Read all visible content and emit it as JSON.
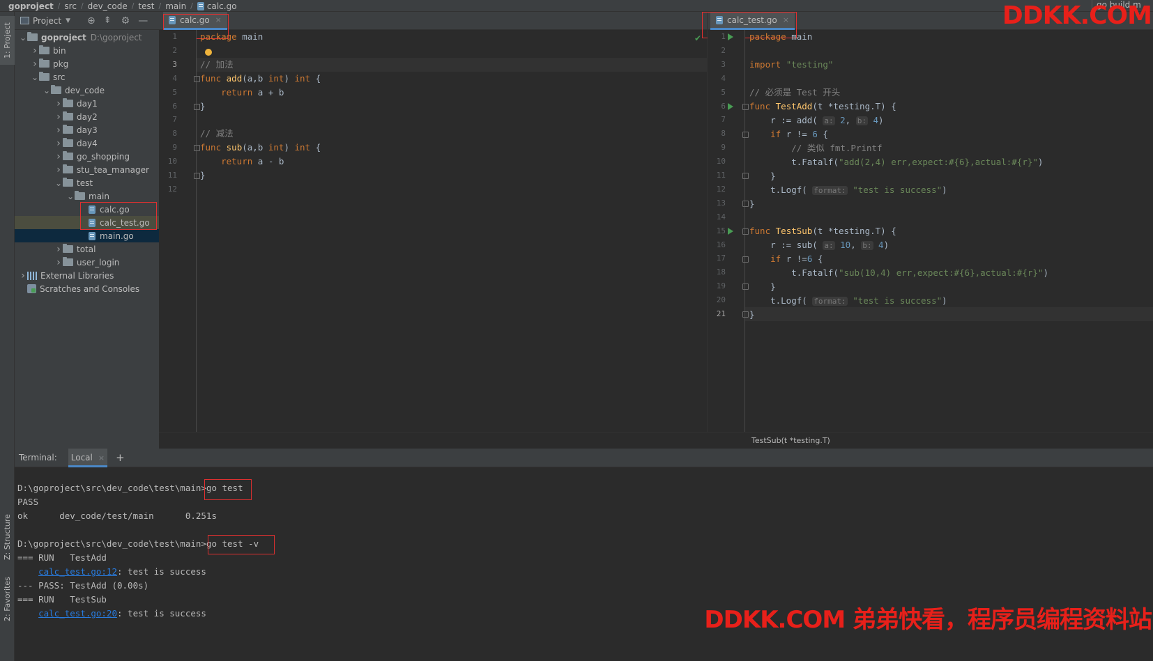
{
  "breadcrumb": [
    "goproject",
    "src",
    "dev_code",
    "test",
    "main",
    "calc.go"
  ],
  "top_right": "go build m",
  "left_strip": {
    "project": "1: Project",
    "structure": "Z: Structure",
    "favorites": "2: Favorites"
  },
  "project_panel": {
    "title": "Project",
    "tree": [
      {
        "label": "goproject",
        "hint": "D:\\goproject",
        "type": "folder",
        "depth": 0,
        "open": true
      },
      {
        "label": "bin",
        "type": "folder",
        "depth": 1
      },
      {
        "label": "pkg",
        "type": "folder",
        "depth": 1
      },
      {
        "label": "src",
        "type": "folder",
        "depth": 1,
        "open": true
      },
      {
        "label": "dev_code",
        "type": "folder",
        "depth": 2,
        "open": true
      },
      {
        "label": "day1",
        "type": "folder",
        "depth": 3
      },
      {
        "label": "day2",
        "type": "folder",
        "depth": 3
      },
      {
        "label": "day3",
        "type": "folder",
        "depth": 3
      },
      {
        "label": "day4",
        "type": "folder",
        "depth": 3
      },
      {
        "label": "go_shopping",
        "type": "folder",
        "depth": 3
      },
      {
        "label": "stu_tea_manager",
        "type": "folder",
        "depth": 3
      },
      {
        "label": "test",
        "type": "folder",
        "depth": 3,
        "open": true
      },
      {
        "label": "main",
        "type": "folder",
        "depth": 4,
        "open": true
      },
      {
        "label": "calc.go",
        "type": "file",
        "depth": 5
      },
      {
        "label": "calc_test.go",
        "type": "file",
        "depth": 5,
        "selected": "olive"
      },
      {
        "label": "main.go",
        "type": "file",
        "depth": 5,
        "selected": "blue"
      },
      {
        "label": "total",
        "type": "folder",
        "depth": 3
      },
      {
        "label": "user_login",
        "type": "folder",
        "depth": 3
      },
      {
        "label": "External Libraries",
        "type": "lib",
        "depth": 0
      },
      {
        "label": "Scratches and Consoles",
        "type": "scratch",
        "depth": 0
      }
    ]
  },
  "left_editor": {
    "tab": "calc.go",
    "line_numbers": [
      "1",
      "2",
      "3",
      "4",
      "5",
      "6",
      "7",
      "8",
      "9",
      "10",
      "11",
      "12"
    ],
    "current_line": "3"
  },
  "right_editor": {
    "tab": "calc_test.go",
    "line_numbers": [
      "1",
      "2",
      "3",
      "4",
      "5",
      "6",
      "7",
      "8",
      "9",
      "10",
      "11",
      "12",
      "13",
      "14",
      "15",
      "16",
      "17",
      "18",
      "19",
      "20",
      "21"
    ],
    "current_line": "21",
    "status_hint": "TestSub(t *testing.T)"
  },
  "terminal": {
    "label": "Terminal:",
    "tab": "Local",
    "add": "+",
    "lines": [
      {
        "text": "D:\\goproject\\src\\dev_code\\test\\main>go test"
      },
      {
        "text": "PASS"
      },
      {
        "text": "ok      dev_code/test/main      0.251s"
      },
      {
        "text": ""
      },
      {
        "text": "D:\\goproject\\src\\dev_code\\test\\main>go test -v"
      },
      {
        "text": "=== RUN   TestAdd"
      },
      {
        "link": "calc_test.go:12",
        "text": ": test is success"
      },
      {
        "text": "--- PASS: TestAdd (0.00s)"
      },
      {
        "text": "=== RUN   TestSub"
      },
      {
        "link": "calc_test.go:20",
        "text": ": test is success"
      }
    ]
  },
  "watermarks": {
    "top": "DDKK.COM",
    "bottom": "DDKK.COM 弟弟快看，程序员编程资料站"
  },
  "colors": {
    "annotation_box": "#e03030",
    "watermark": "#e8201a"
  }
}
